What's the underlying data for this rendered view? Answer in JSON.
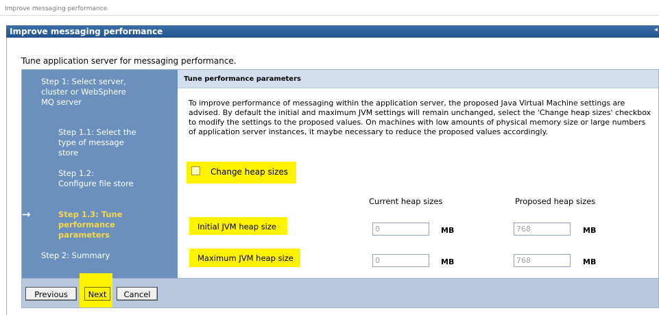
{
  "breadcrumb": "Improve messaging performance",
  "title": "Improve messaging performance",
  "intro": "Tune application server for messaging performance.",
  "steps": [
    {
      "label": "Step  1: Select server, cluster or WebSphere MQ server",
      "current": false
    },
    {
      "label": "Step  1.1: Select the type of message store",
      "current": false
    },
    {
      "label": "Step  1.2: Configure file store",
      "current": false
    },
    {
      "label": "Step  1.3: Tune performance parameters",
      "current": true
    },
    {
      "label": "Step  2: Summary",
      "current": false
    }
  ],
  "current_arrow": "→",
  "section": {
    "header": "Tune performance parameters",
    "description": "To improve performance of messaging within the application server, the proposed Java Virtual Machine settings are advised. By default the initial and maximum JVM settings will remain unchanged, select the 'Change heap sizes' checkbox to modify the settings to the proposed values. On machines with low amounts of physical memory size or large numbers of application server instances, it maybe necessary to reduce the proposed values accordingly."
  },
  "change_heap": {
    "label": "Change heap sizes",
    "checked": false
  },
  "columns": {
    "current": "Current heap sizes",
    "proposed": "Proposed heap sizes"
  },
  "rows": [
    {
      "label": "Initial JVM heap size",
      "current": "0",
      "current_unit": "MB",
      "proposed": "768",
      "proposed_unit": "MB"
    },
    {
      "label": "Maximum JVM heap size",
      "current": "0",
      "current_unit": "MB",
      "proposed": "768",
      "proposed_unit": "MB"
    }
  ],
  "buttons": {
    "previous": "Previous",
    "next": "Next",
    "cancel": "Cancel"
  },
  "colors": {
    "title_bar": "#20538f",
    "steps_panel": "#6b90bd",
    "current_step": "#f5d94d",
    "highlight": "#fff200"
  }
}
